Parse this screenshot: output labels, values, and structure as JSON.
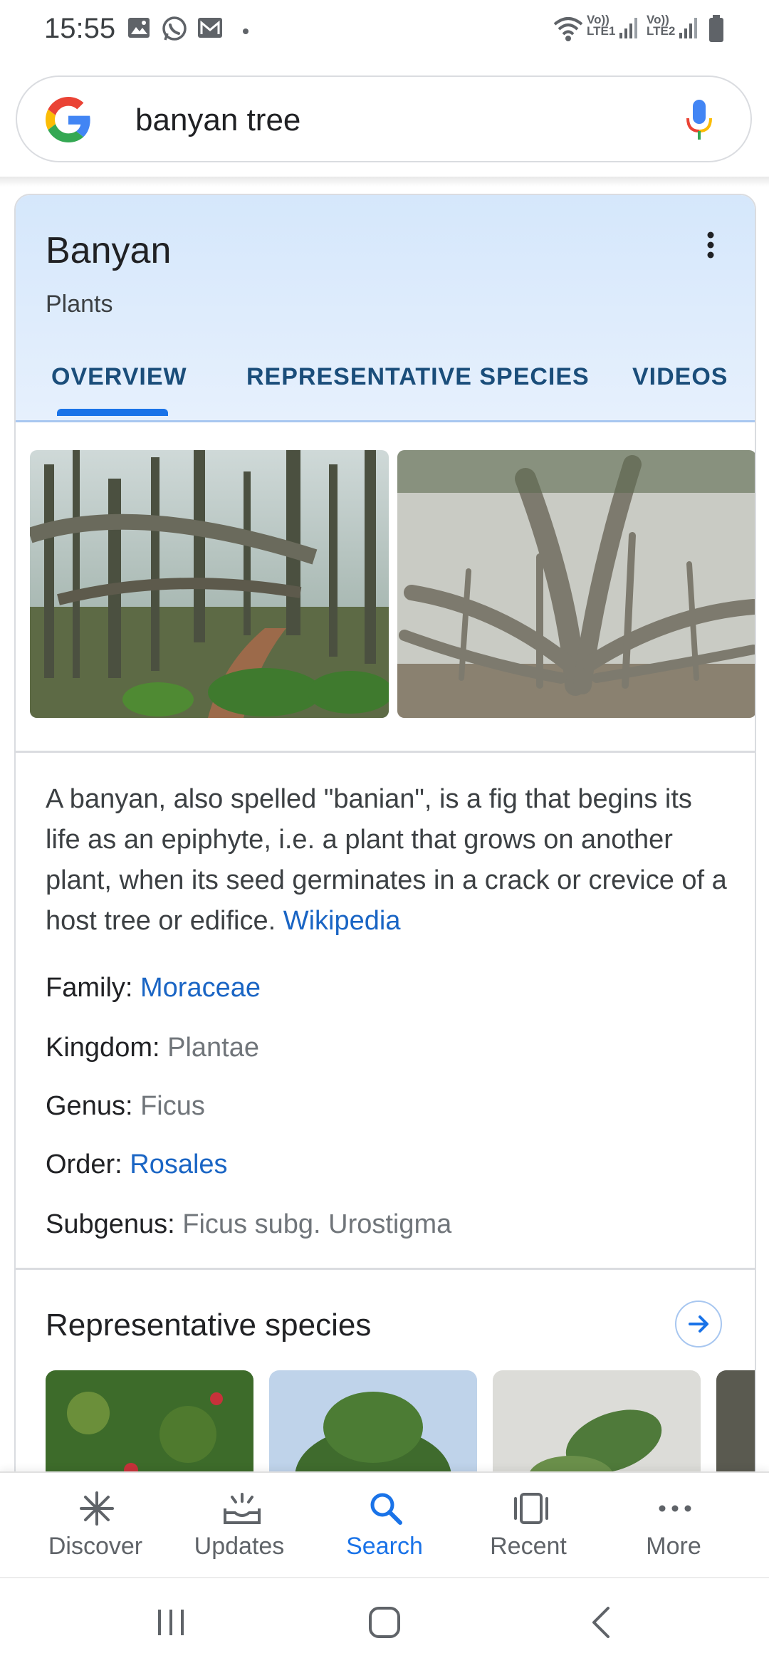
{
  "status_bar": {
    "time": "15:55",
    "icons": [
      "gallery-icon",
      "whatsapp-icon",
      "mail-icon",
      "dot-icon",
      "wifi-icon",
      "signal-lte1-icon",
      "signal-lte2-icon",
      "battery-icon"
    ],
    "lte1": "LTE1",
    "lte2": "LTE2",
    "volte": "Vo))"
  },
  "search": {
    "query": "banyan tree"
  },
  "panel": {
    "title": "Banyan",
    "subtitle": "Plants",
    "tabs": [
      {
        "label": "OVERVIEW",
        "active": true
      },
      {
        "label": "REPRESENTATIVE SPECIES",
        "active": false
      },
      {
        "label": "VIDEOS",
        "active": false
      }
    ],
    "description": "A banyan, also spelled \"banian\", is a fig that begins its life as an epiphyte, i.e. a plant that grows on another plant, when its seed germinates in a crack or crevice of a host tree or edifice.",
    "source_link": "Wikipedia",
    "facts": [
      {
        "label": "Family:",
        "value": "Moraceae",
        "is_link": true
      },
      {
        "label": "Kingdom:",
        "value": "Plantae",
        "is_link": false
      },
      {
        "label": "Genus:",
        "value": "Ficus",
        "is_link": false
      },
      {
        "label": "Order:",
        "value": "Rosales",
        "is_link": true
      },
      {
        "label": "Subgenus:",
        "value": "Ficus subg. Urostigma",
        "is_link": false
      }
    ],
    "representative_title": "Representative species"
  },
  "bottom_nav": [
    {
      "label": "Discover",
      "icon": "asterisk-icon",
      "active": false
    },
    {
      "label": "Updates",
      "icon": "updates-tray-icon",
      "active": false
    },
    {
      "label": "Search",
      "icon": "search-icon",
      "active": true
    },
    {
      "label": "Recent",
      "icon": "recent-cards-icon",
      "active": false
    },
    {
      "label": "More",
      "icon": "more-dots-icon",
      "active": false
    }
  ],
  "colors": {
    "accent": "#1a73e8",
    "link": "#1a65c4",
    "panel_header": "#d5e7fb",
    "tab_text": "#1a4d7a"
  }
}
